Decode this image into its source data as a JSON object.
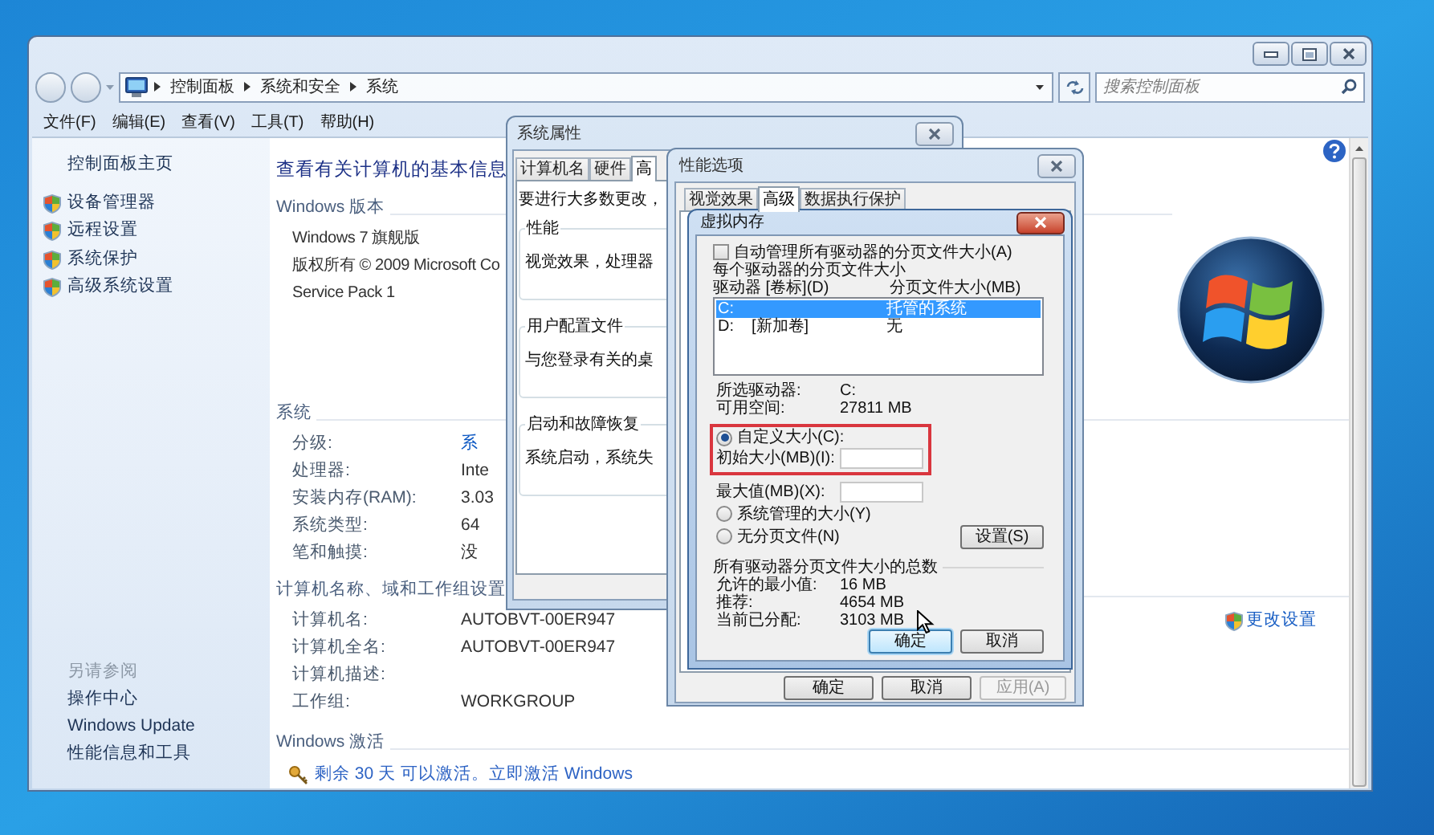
{
  "explorer": {
    "breadcrumb": [
      "控制面板",
      "系统和安全",
      "系统"
    ],
    "search": {
      "placeholder": "搜索控制面板"
    },
    "menu": [
      "文件(F)",
      "编辑(E)",
      "查看(V)",
      "工具(T)",
      "帮助(H)"
    ],
    "sidebar": {
      "home": "控制面板主页",
      "tasks": [
        "设备管理器",
        "远程设置",
        "系统保护",
        "高级系统设置"
      ],
      "see_also_title": "另请参阅",
      "see_also": [
        "操作中心",
        "Windows Update",
        "性能信息和工具"
      ]
    },
    "title": "查看有关计算机的基本信息",
    "edition": {
      "heading": "Windows 版本",
      "lines": [
        "Windows 7 旗舰版",
        "版权所有 © 2009 Microsoft Co",
        "Service Pack 1"
      ]
    },
    "system": {
      "heading": "系统",
      "rows": [
        {
          "label": "分级:",
          "value": "系",
          "link": true
        },
        {
          "label": "处理器:",
          "value": "Inte",
          "link": false
        },
        {
          "label": "安装内存(RAM):",
          "value": "3.03",
          "link": false
        },
        {
          "label": "系统类型:",
          "value": "64",
          "link": false
        },
        {
          "label": "笔和触摸:",
          "value": "没",
          "link": false
        }
      ]
    },
    "computer": {
      "heading": "计算机名称、域和工作组设置",
      "rows": [
        {
          "label": "计算机名:",
          "value": "AUTOBVT-00ER947"
        },
        {
          "label": "计算机全名:",
          "value": "AUTOBVT-00ER947"
        },
        {
          "label": "计算机描述:"
        },
        {
          "label": "工作组:",
          "value": "WORKGROUP"
        }
      ],
      "action": "更改设置"
    },
    "activation": {
      "heading": "Windows 激活",
      "link": "剩余 30 天 可以激活。立即激活 Windows"
    }
  },
  "system_properties": {
    "title": "系统属性",
    "tabs": [
      {
        "label": "计算机名",
        "selected": false
      },
      {
        "label": "硬件",
        "selected": false
      },
      {
        "label": "高",
        "selected": true
      }
    ],
    "intro": "要进行大多数更改，",
    "groups": [
      {
        "title": "性能",
        "text": "视觉效果，处理器"
      },
      {
        "title": "用户配置文件",
        "text": "与您登录有关的桌"
      },
      {
        "title": "启动和故障恢复",
        "text": "系统启动，系统失"
      }
    ]
  },
  "performance_options": {
    "title": "性能选项",
    "tabs": [
      {
        "label": "视觉效果",
        "selected": false
      },
      {
        "label": "高级",
        "selected": true
      },
      {
        "label": "数据执行保护",
        "selected": false
      }
    ],
    "buttons": [
      {
        "label": "确定",
        "disabled": false
      },
      {
        "label": "取消",
        "disabled": false
      },
      {
        "label": "应用(A)",
        "disabled": true
      }
    ]
  },
  "virtual_memory": {
    "title": "虚拟内存",
    "auto_manage": {
      "label": "自动管理所有驱动器的分页文件大小(A)",
      "checked": false
    },
    "per_drive_title": "每个驱动器的分页文件大小",
    "columns": [
      "驱动器 [卷标](D)",
      "分页文件大小(MB)"
    ],
    "drives": [
      {
        "drive": "C:",
        "size": "托管的系统",
        "selected": true
      },
      {
        "drive": "D:",
        "label": "[新加卷]",
        "size": "无",
        "selected": false
      }
    ],
    "selected_drive": {
      "label": "所选驱动器:",
      "value": "C:"
    },
    "free_space": {
      "label": "可用空间:",
      "value": "27811 MB"
    },
    "options": [
      {
        "label": "自定义大小(C):",
        "selected": true
      },
      {
        "label": "系统管理的大小(Y)",
        "selected": false
      },
      {
        "label": "无分页文件(N)",
        "selected": false
      }
    ],
    "initial_size": {
      "label": "初始大小(MB)(I):"
    },
    "maximum_size": {
      "label": "最大值(MB)(X):"
    },
    "set_button": "设置(S)",
    "totals": {
      "heading": "所有驱动器分页文件大小的总数",
      "rows": [
        {
          "label": "允许的最小值:",
          "value": "16 MB"
        },
        {
          "label": "推荐:",
          "value": "4654 MB"
        },
        {
          "label": "当前已分配:",
          "value": "3103 MB"
        }
      ]
    },
    "buttons": [
      {
        "label": "确定",
        "default": true
      },
      {
        "label": "取消",
        "default": false
      }
    ]
  }
}
